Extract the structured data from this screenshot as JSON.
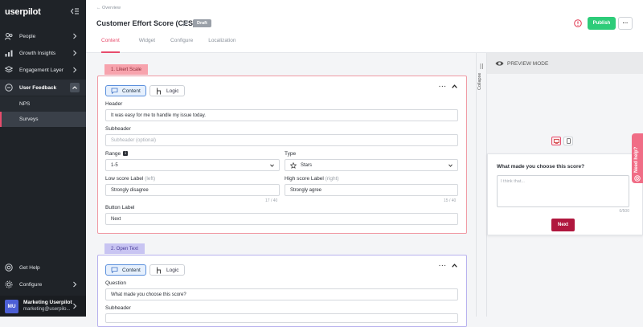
{
  "app": {
    "logo_text": "userpilot"
  },
  "sidebar": {
    "items": [
      {
        "label": "People"
      },
      {
        "label": "Growth Insights"
      },
      {
        "label": "Engagement Layer"
      },
      {
        "label": "User Feedback"
      }
    ],
    "subitems": [
      {
        "label": "NPS"
      },
      {
        "label": "Surveys"
      }
    ],
    "bottom": [
      {
        "label": "Get Help"
      },
      {
        "label": "Configure"
      }
    ],
    "user": {
      "initials": "MU",
      "name": "Marketing Userpilot",
      "email": "marketing@userpilo..."
    }
  },
  "header": {
    "breadcrumb": "← Overview",
    "title": "Customer Effort Score (CES)",
    "status_badge": "Draft",
    "publish_label": "Publish",
    "more_label": "···",
    "tabs": [
      {
        "label": "Content"
      },
      {
        "label": "Widget"
      },
      {
        "label": "Configure"
      },
      {
        "label": "Localization"
      }
    ]
  },
  "likert": {
    "tag": "1. Likert Scale",
    "content_btn": "Content",
    "logic_btn": "Logic",
    "menu": "···",
    "header_label": "Header",
    "header_value": "It was easy for me to handle my issue today.",
    "subheader_label": "Subheader",
    "subheader_placeholder": "Subheader (optional)",
    "range_label": "Range",
    "range_value": "1-5",
    "type_label": "Type",
    "type_value": "Stars",
    "low_label": "Low score Label",
    "low_hint": "(left)",
    "low_value": "Strongly disagree",
    "low_count": "17 / 40",
    "high_label": "High score Label",
    "high_hint": "(right)",
    "high_value": "Strongly agree",
    "high_count": "15 / 40",
    "button_label": "Button Label",
    "button_value": "Next"
  },
  "open_text": {
    "tag": "2. Open Text",
    "content_btn": "Content",
    "logic_btn": "Logic",
    "menu": "···",
    "question_label": "Question",
    "question_value": "What made you choose this score?",
    "subheader_label": "Subheader"
  },
  "rail": {
    "label": "Collapse"
  },
  "preview": {
    "title": "PREVIEW MODE",
    "question": "What made you choose this score?",
    "placeholder": "I think that...",
    "counter": "0/500",
    "next_label": "Next"
  },
  "help_tab": {
    "label": "Need help?"
  },
  "colors": {
    "accent": "#e74c6c",
    "publish": "#2dcc79",
    "survey_button": "#b0173e",
    "sidebar_bg": "#1f2328"
  }
}
